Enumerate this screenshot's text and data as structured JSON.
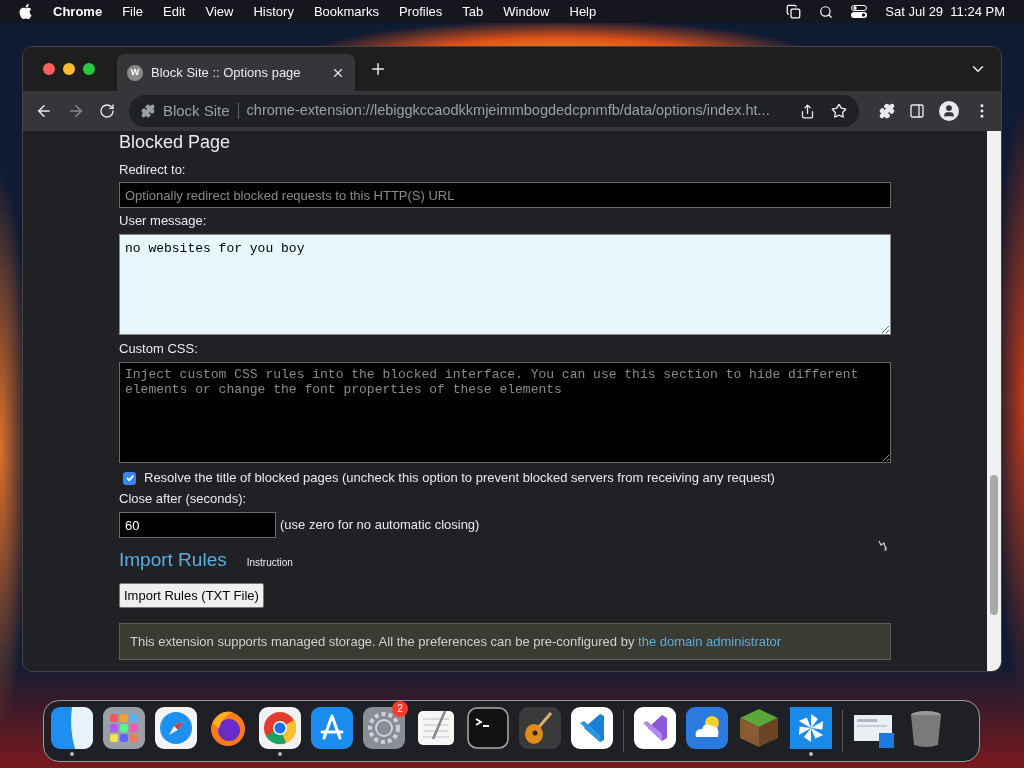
{
  "menu_bar": {
    "app_name": "Chrome",
    "menus": [
      "File",
      "Edit",
      "View",
      "History",
      "Bookmarks",
      "Profiles",
      "Tab",
      "Window",
      "Help"
    ],
    "clock": "Sat Jul 29  11:24 PM"
  },
  "browser": {
    "tabs": [
      {
        "favicon": "W",
        "title": "Block Site :: Options page",
        "selected": true
      }
    ],
    "site_chip": "Block Site",
    "url": "chrome-extension://lebiggkccaodkkmjeimmbogdedcpnmfb/data/options/index.ht..."
  },
  "page": {
    "section_title": "Blocked Page",
    "redirect": {
      "label": "Redirect to:",
      "placeholder": "Optionally redirect blocked requests to this HTTP(S) URL"
    },
    "user_message": {
      "label": "User message:",
      "value": "no websites for you boy"
    },
    "custom_css": {
      "label": "Custom CSS:",
      "placeholder": "Inject custom CSS rules into the blocked interface. You can use this section to hide different elements or change the font properties of these elements"
    },
    "resolve_title": {
      "label": "Resolve the title of blocked pages (uncheck this option to prevent blocked servers from receiving any request)",
      "checked": true
    },
    "close_after": {
      "label": "Close after (seconds):",
      "value": "60",
      "hint": "(use zero for no automatic closing)"
    },
    "import_title": "Import Rules",
    "instruction": "Instruction",
    "import_button": "Import Rules (TXT File)",
    "notice": {
      "text": "This extension supports managed storage. All the preferences can be pre-configured by",
      "link": "the domain administrator"
    }
  },
  "dock": {
    "groups": [
      [
        {
          "running": true
        },
        {
          "running": false
        },
        {
          "running": false
        },
        {
          "running": false
        },
        {
          "running": true
        },
        {
          "running": false
        },
        {
          "running": false,
          "badge": "2"
        },
        {
          "running": false
        },
        {
          "running": false
        },
        {
          "running": false
        },
        {
          "running": false
        }
      ],
      [
        {
          "running": false
        },
        {
          "running": false
        },
        {
          "running": false
        },
        {
          "running": true
        }
      ],
      [
        {
          "running": false
        },
        {
          "running": false
        }
      ]
    ]
  }
}
